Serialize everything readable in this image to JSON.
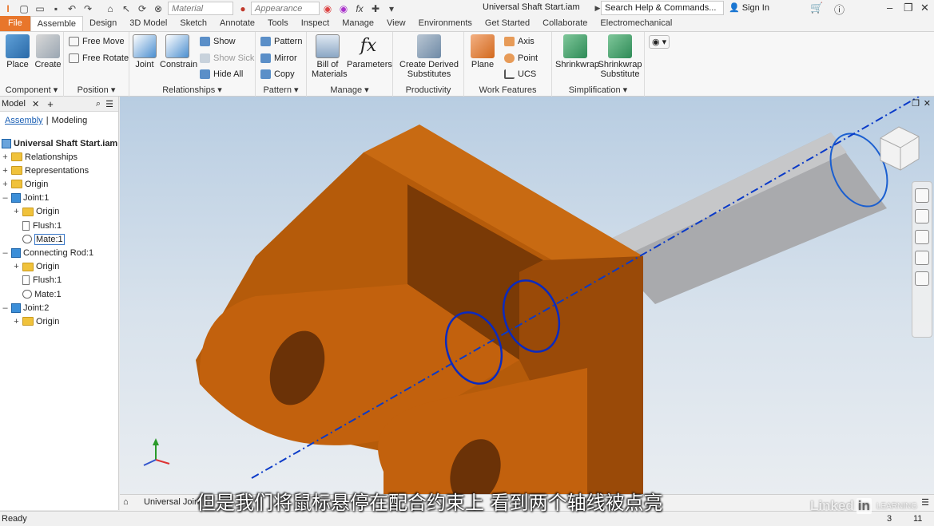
{
  "titlebar": {
    "material_placeholder": "Material",
    "appearance_placeholder": "Appearance",
    "title": "Universal Shaft Start.iam",
    "search": "Search Help & Commands...",
    "sign_in": "Sign In"
  },
  "menu": {
    "tabs": [
      "File",
      "Assemble",
      "Design",
      "3D Model",
      "Sketch",
      "Annotate",
      "Tools",
      "Inspect",
      "Manage",
      "View",
      "Environments",
      "Get Started",
      "Collaborate",
      "Electromechanical"
    ],
    "active": "Assemble"
  },
  "ribbon": {
    "component": {
      "label": "Component ▾",
      "place": "Place",
      "create": "Create"
    },
    "position": {
      "label": "Position ▾",
      "free_move": "Free Move",
      "free_rotate": "Free Rotate"
    },
    "relationships": {
      "label": "Relationships ▾",
      "joint": "Joint",
      "constrain": "Constrain",
      "show": "Show",
      "show_sick": "Show Sick",
      "hide_all": "Hide All"
    },
    "pattern": {
      "label": "Pattern ▾",
      "pattern": "Pattern",
      "mirror": "Mirror",
      "copy": "Copy"
    },
    "manage": {
      "label": "Manage ▾",
      "bom_line1": "Bill of",
      "bom_line2": "Materials",
      "parameters": "Parameters"
    },
    "productivity": {
      "label": "Productivity",
      "derived_line1": "Create Derived",
      "derived_line2": "Substitutes"
    },
    "work_features": {
      "label": "Work Features",
      "plane": "Plane",
      "axis": "Axis",
      "point": "Point",
      "ucs": "UCS"
    },
    "simplification": {
      "label": "Simplification ▾",
      "shrinkwrap": "Shrinkwrap",
      "shrinkwrap_sub_line1": "Shrinkwrap",
      "shrinkwrap_sub_line2": "Substitute"
    }
  },
  "browser": {
    "tab": "Model",
    "assembly_link": "Assembly",
    "modeling": "Modeling",
    "root": "Universal Shaft Start.iam",
    "rows": [
      {
        "label": "Relationships"
      },
      {
        "label": "Representations"
      },
      {
        "label": "Origin"
      },
      {
        "label": "Joint:1"
      },
      {
        "label": "Origin"
      },
      {
        "label": "Flush:1"
      },
      {
        "label": "Mate:1"
      },
      {
        "label": "Connecting Rod:1"
      },
      {
        "label": "Origin"
      },
      {
        "label": "Flush:1"
      },
      {
        "label": "Mate:1"
      },
      {
        "label": "Joint:2"
      },
      {
        "label": "Origin"
      }
    ]
  },
  "viewport_tab": "Universal Joint",
  "status": {
    "text": "Ready",
    "count1": "3",
    "count2": "11"
  },
  "subtitle": "但是我们将鼠标悬停在配合约束上 看到两个轴线被点亮",
  "watermark": {
    "brand": "Linked",
    "in": "in",
    "learning": "LEARNING"
  },
  "colors": {
    "file_tab": "#e8762b",
    "part": "#b85a0c",
    "shaft": "#a9a9a9",
    "axis": "#0a3ac8"
  }
}
